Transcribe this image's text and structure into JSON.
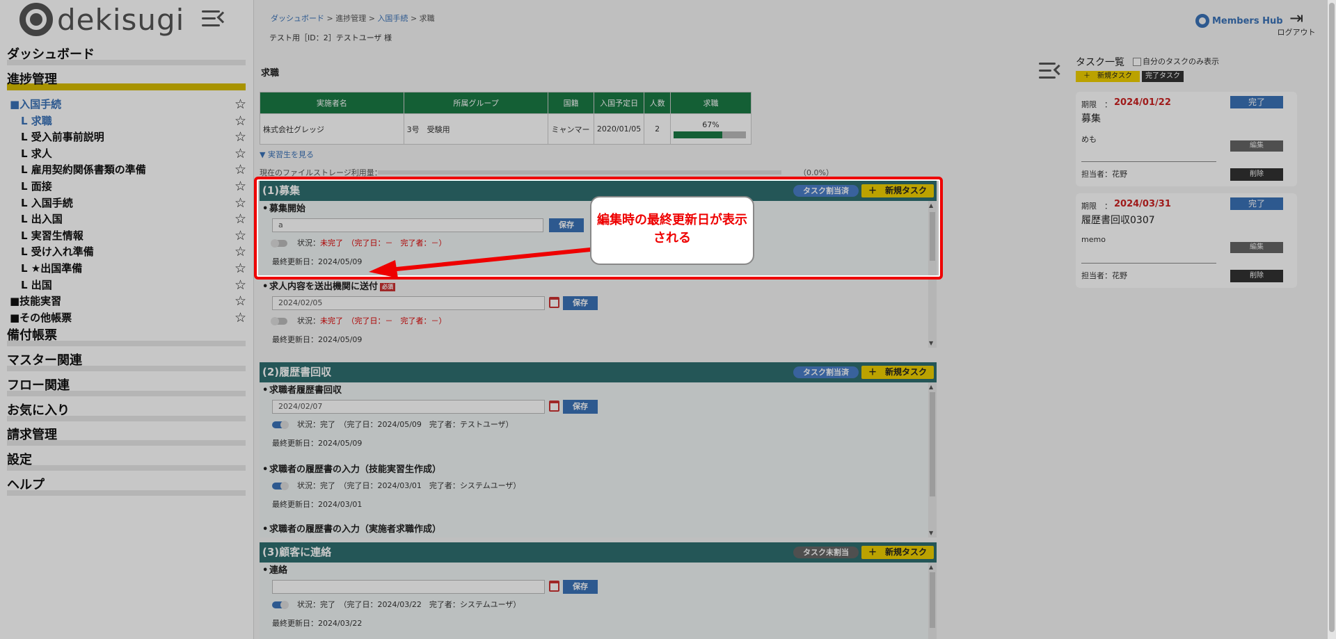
{
  "app": {
    "logo_text": "dekisugi"
  },
  "sidebar": {
    "top_items": [
      {
        "label": "ダッシュボード"
      },
      {
        "label": "進捗管理"
      }
    ],
    "sub_items": [
      {
        "label": "■入国手続"
      },
      {
        "label": "L 求職"
      },
      {
        "label": "L 受入前事前説明"
      },
      {
        "label": "L 求人"
      },
      {
        "label": "L 雇用契約関係書類の準備"
      },
      {
        "label": "L 面接"
      },
      {
        "label": "L 入国手続"
      },
      {
        "label": "L 出入国"
      },
      {
        "label": "L 実習生情報"
      },
      {
        "label": "L 受け入れ準備"
      },
      {
        "label": "L ★出国準備"
      },
      {
        "label": "L 出国"
      },
      {
        "label": "■技能実習"
      },
      {
        "label": "■その他帳票"
      }
    ],
    "bottom_items": [
      {
        "label": "備付帳票"
      },
      {
        "label": "マスター関連"
      },
      {
        "label": "フロー関連"
      },
      {
        "label": "お気に入り"
      },
      {
        "label": "請求管理"
      },
      {
        "label": "設定"
      },
      {
        "label": "ヘルプ"
      }
    ],
    "star_icon": "☆",
    "accent_color": "#d8bd00"
  },
  "header": {
    "breadcrumb": [
      "ダッシュボード",
      "進捗管理",
      "入国手続",
      "求職"
    ],
    "separator": ">",
    "user_title": "テスト用［ID：2］テストユーザ 様",
    "members_hub": "Members Hub",
    "logout": "ログアウト"
  },
  "page": {
    "title": "求職"
  },
  "info_table": {
    "headers": [
      "実施者名",
      "所属グループ",
      "国籍",
      "入国予定日",
      "人数",
      "求職"
    ],
    "row": {
      "company": "株式会社グレッジ",
      "group": "3号　受験用",
      "nationality": "ミャンマー",
      "entry_date": "2020/01/05",
      "count": "2",
      "progress_label": "67%",
      "progress": 0.67
    }
  },
  "show_trainees": "▼ 実習生を見る",
  "file_storage": {
    "label": "現在のファイルストレージ利用量：",
    "value": "（0.0%）"
  },
  "sections": [
    {
      "title": "(1)募集",
      "assign": "タスク割当済",
      "new_task": "＋　新規タスク",
      "assign_color": "#4a7ec8",
      "tasks": [
        {
          "title": "募集開始",
          "input": "a",
          "save": "保存",
          "status_label": "状況：",
          "status": "未完了　（完了日：－　完了者：－）",
          "updated": "最終更新日：2024/05/09"
        },
        {
          "title": "求人内容を送出機関に送付",
          "badge": "必須",
          "input": "2024/02/05",
          "save": "保存",
          "status_label": "状況：",
          "status": "未完了　（完了日：－　完了者：－）",
          "updated": "最終更新日：2024/05/09"
        }
      ]
    },
    {
      "title": "(2)履歴書回収",
      "assign": "タスク割当済",
      "new_task": "＋　新規タスク",
      "assign_color": "#4a7ec8",
      "tasks": [
        {
          "title": "求職者履歴書回収",
          "input": "2024/02/07",
          "save": "保存",
          "status_label": "状況：",
          "status": "完了　（完了日：2024/05/09　完了者：テストユーザ）",
          "updated": "最終更新日：2024/05/09"
        },
        {
          "title": "求職者の履歴書の入力（技能実習生作成）",
          "save": "保存",
          "status_label": "状況：",
          "status": "完了　（完了日：2024/03/01　完了者：システムユーザ）",
          "updated": "最終更新日：2024/03/01"
        },
        {
          "title": "求職者の履歴書の入力（実施者求職作成）"
        }
      ]
    },
    {
      "title": "(3)顧客に連絡",
      "assign": "タスク未割当",
      "new_task": "＋　新規タスク",
      "assign_color": "#666666",
      "tasks": [
        {
          "title": "連絡",
          "input": "",
          "save": "保存",
          "status_label": "状況：",
          "status": "完了　（完了日：2024/03/22　完了者：システムユーザ）",
          "updated": "最終更新日：2024/03/22"
        }
      ]
    }
  ],
  "task_panel": {
    "title": "タスク一覧",
    "only_mine": "自分のタスクのみ表示",
    "new_task": "＋　新規タスク",
    "done_task": "完了タスク",
    "cards": [
      {
        "due_label": "期限　：",
        "due": "2024/01/22",
        "done": "完了",
        "title": "募集",
        "memo": "めも",
        "edit": "編集",
        "owner": "担当者：花野",
        "delete": "削除"
      },
      {
        "due_label": "期限　：",
        "due": "2024/03/31",
        "done": "完了",
        "title": "履歴書回収0307",
        "memo": "memo",
        "edit": "編集",
        "owner": "担当者：花野",
        "delete": "削除"
      }
    ]
  },
  "annotation": {
    "callout": "編集時の最終更新日が表示される",
    "color": "#e00000"
  }
}
